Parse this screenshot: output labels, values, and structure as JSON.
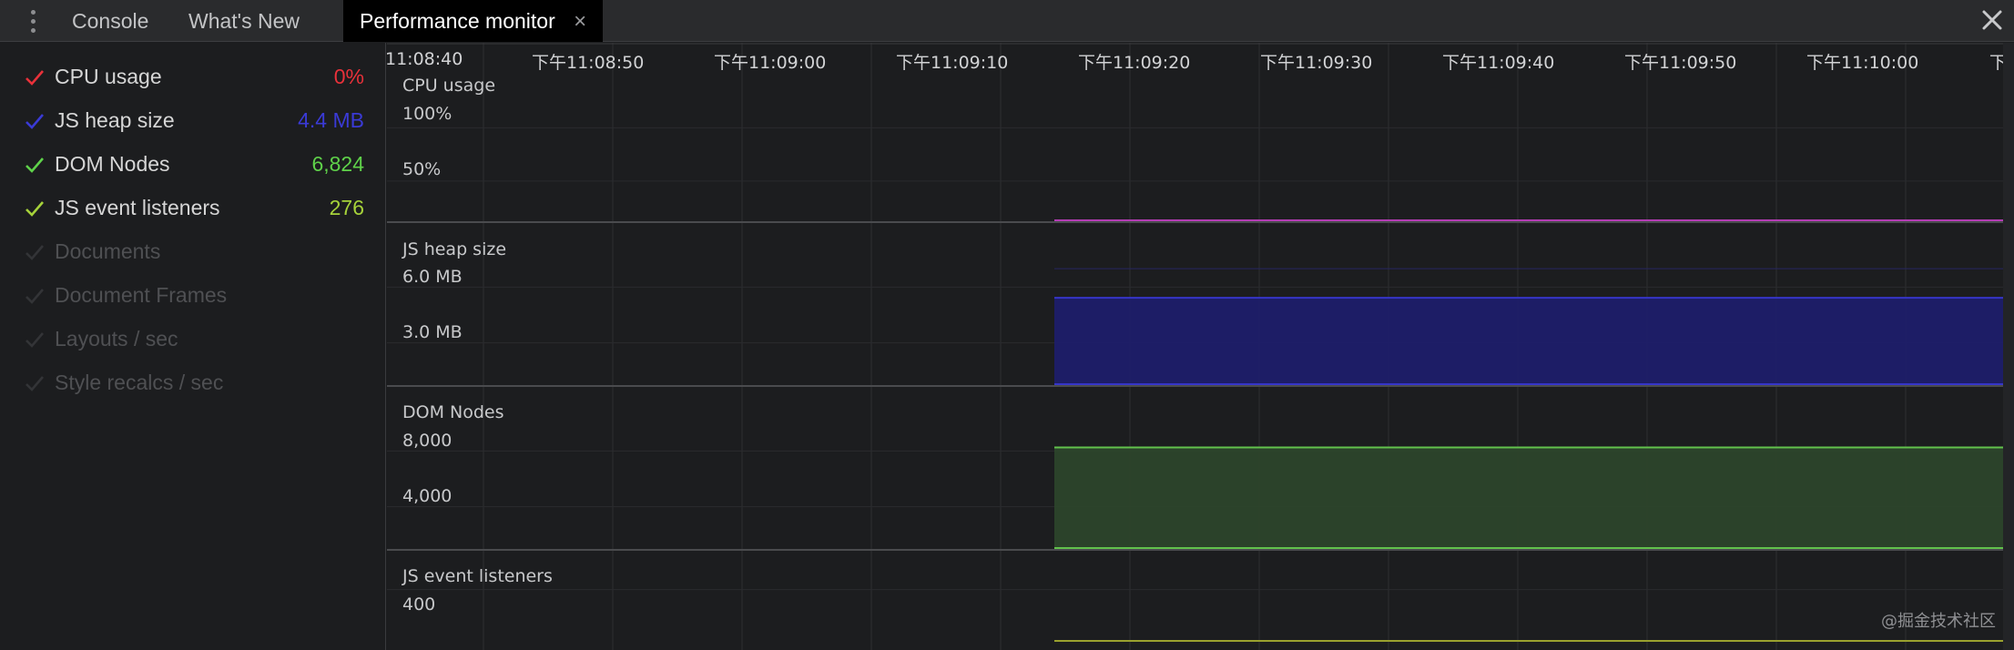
{
  "tabbar": {
    "tabs": [
      {
        "label": "Console",
        "active": false
      },
      {
        "label": "What's New",
        "active": false
      },
      {
        "label": "Performance monitor",
        "active": true
      }
    ],
    "tab_close_glyph": "×",
    "more_icon": "kebab-menu-icon",
    "close_icon": "close-icon"
  },
  "metrics": [
    {
      "label": "CPU usage",
      "value": "0%",
      "enabled": true,
      "color": "#e8313a"
    },
    {
      "label": "JS heap size",
      "value": "4.4 MB",
      "enabled": true,
      "color": "#3a3ad6"
    },
    {
      "label": "DOM Nodes",
      "value": "6,824",
      "enabled": true,
      "color": "#5fd24a"
    },
    {
      "label": "JS event listeners",
      "value": "276",
      "enabled": true,
      "color": "#a6d23a"
    },
    {
      "label": "Documents",
      "value": "",
      "enabled": false,
      "color": "#4a4b4e"
    },
    {
      "label": "Document Frames",
      "value": "",
      "enabled": false,
      "color": "#4a4b4e"
    },
    {
      "label": "Layouts / sec",
      "value": "",
      "enabled": false,
      "color": "#4a4b4e"
    },
    {
      "label": "Style recalcs / sec",
      "value": "",
      "enabled": false,
      "color": "#4a4b4e"
    }
  ],
  "timeline": {
    "labels": [
      "11:08:40",
      "下午11:08:50",
      "下午11:09:00",
      "下午11:09:10",
      "下午11:09:20",
      "下午11:09:30",
      "下午11:09:40",
      "下午11:09:50",
      "下午11:10:00",
      "下"
    ]
  },
  "graphs": [
    {
      "title": "CPU usage",
      "ticks": [
        "100%",
        "50%"
      ],
      "line_color": "#b33cb3",
      "fill_color": "",
      "level_fraction": 0.0
    },
    {
      "title": "JS heap size",
      "ticks": [
        "6.0 MB",
        "3.0 MB"
      ],
      "line_color": "#3535c8",
      "fill_color": "#1e1e6a",
      "level_fraction": 0.73
    },
    {
      "title": "DOM Nodes",
      "ticks": [
        "8,000",
        "4,000"
      ],
      "line_color": "#62c24c",
      "fill_color": "#2c452b",
      "level_fraction": 0.85
    },
    {
      "title": "JS event listeners",
      "ticks": [
        "400"
      ],
      "line_color": "#9aa12e",
      "fill_color": "#3a3d1f",
      "level_fraction": 0.69
    }
  ],
  "watermark": "@掘金技术社区"
}
